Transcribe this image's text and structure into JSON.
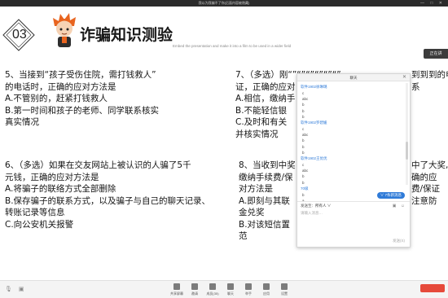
{
  "window": {
    "title": "我以为我骗不了你(后面内容被隐藏)",
    "controls": "— □ ✕"
  },
  "slide": {
    "number": "03",
    "title": "诈骗知识测验",
    "notice": "Embed the presentation and make it into a film to be used in a wider field",
    "tag": "正在讲"
  },
  "questions": {
    "q5": [
      "5、当接到“孩子受伤住院，需打钱救人”",
      "的电话时，正确的应对方法是",
      "A.不管别的，赶紧打钱救人",
      "B.第一时间和孩子的老师、同学联系核实",
      "真实情况"
    ],
    "q6": [
      "6、（多选）如果在交友网站上被认识的人骗了5千",
      "元钱，正确的应对方法是",
      "A.将骗子的联络方式全部删除",
      "B.保存骗子的联系方式，以及骗子与自己的聊天记录、",
      "转账记录等信息",
      "C.向公安机关报警"
    ],
    "q7": [
      "7、（多选）刚“”“”“”“”“”“”",
      "证，正确的应对",
      "A.相信，缴纳手",
      "B.不能轻信银",
      "C.及时和有关",
      "并核实情况"
    ],
    "q8": [
      "8、当收到中奖",
      "缴纳手续费/保",
      "对方法是",
      "A.即刻与其联",
      "金兑奖",
      "B.对该短信置"
    ]
  },
  "questions_right_tails": {
    "q7": [
      "到到到的电",
      "",
      "",
      "",
      "系",
      ""
    ],
    "q8": [
      "中了大奖,",
      "确的应",
      "",
      "费/保证",
      "",
      "注意防"
    ],
    "q8_last": "范"
  },
  "chat": {
    "title": "聊天",
    "close": "✕",
    "messages": [
      {
        "user": "软件1902徐琳璐",
        "lines": [
          "c",
          "abc",
          "b",
          "b",
          "b"
        ]
      },
      {
        "user": "软件1902罗碧媛",
        "lines": [
          "c",
          "abc",
          "b",
          "b",
          "b"
        ]
      },
      {
        "user": "软件1902王优优",
        "lines": [
          "c",
          "abc",
          "b",
          "b"
        ]
      },
      {
        "user": "70级",
        "lines": [
          "b",
          "a"
        ]
      }
    ],
    "new_messages": "∨ 7条新消息",
    "send_to_label": "发送至：",
    "send_to_value": "所有人 ∨",
    "input_placeholder": "请输入消息…",
    "send_label": "发送(S)"
  },
  "taskbar": {
    "items": [
      "共享屏幕",
      "邀请",
      "成员(35)",
      "聊天",
      "举手",
      "应用",
      "设置"
    ]
  }
}
